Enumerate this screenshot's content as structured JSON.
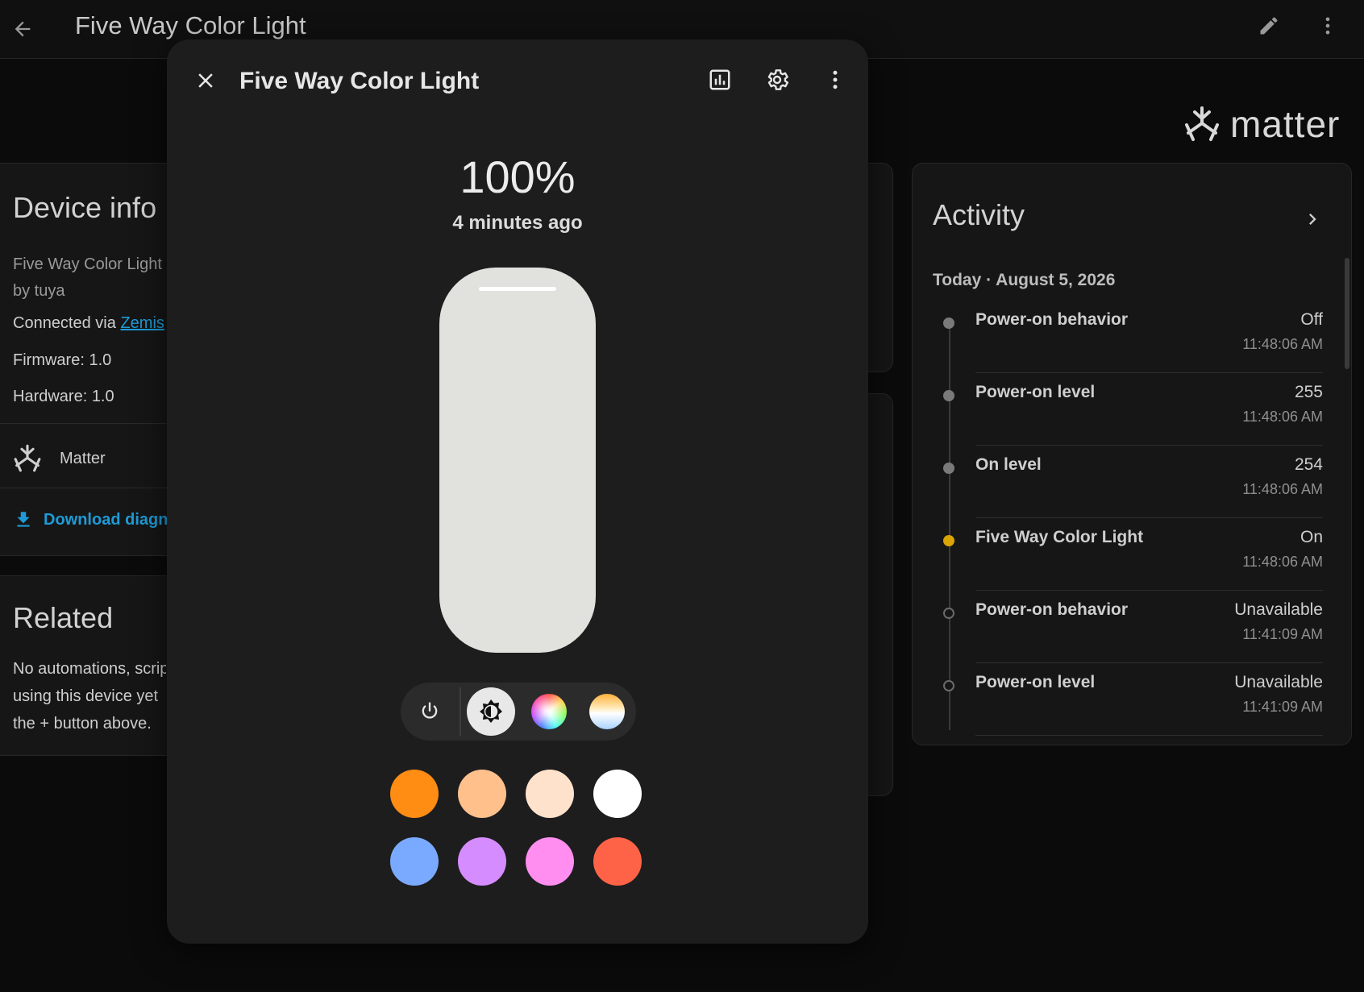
{
  "appbar": {
    "title": "Five Way Color Light"
  },
  "brand": {
    "word": "matter"
  },
  "device_info": {
    "title": "Device info",
    "model": "Five Way Color Light",
    "manufacturer": "by tuya",
    "connected_label": "Connected via",
    "connected_link": "Zemis",
    "firmware": "Firmware: 1.0",
    "hardware": "Hardware: 1.0",
    "integration": "Matter",
    "download": "Download diagnostics"
  },
  "related": {
    "title": "Related",
    "line1": "No automations, scripts,",
    "line2": "using this device yet",
    "line3": "the + button above."
  },
  "activity": {
    "title": "Activity",
    "date": "Today · August 5, 2026",
    "items": [
      {
        "name": "Power-on behavior",
        "value": "Off",
        "time": "11:48:06 AM",
        "dot": "#7a7a7a"
      },
      {
        "name": "Power-on level",
        "value": "255",
        "time": "11:48:06 AM",
        "dot": "#7a7a7a"
      },
      {
        "name": "On level",
        "value": "254",
        "time": "11:48:06 AM",
        "dot": "#7a7a7a"
      },
      {
        "name": "Five Way Color Light",
        "value": "On",
        "time": "11:48:06 AM",
        "dot": "#d9a404"
      },
      {
        "name": "Power-on behavior",
        "value": "Unavailable",
        "time": "11:41:09 AM",
        "dot": "hollow"
      },
      {
        "name": "Power-on level",
        "value": "Unavailable",
        "time": "11:41:09 AM",
        "dot": "hollow"
      }
    ]
  },
  "dialog": {
    "title": "Five Way Color Light",
    "brightness": "100%",
    "brightness_level": 1.0,
    "last_changed": "4 minutes ago",
    "modes": [
      "power",
      "brightness",
      "color",
      "color-temperature"
    ],
    "active_mode": "brightness",
    "presets": [
      "#ff8c13",
      "#ffc08c",
      "#ffe2cc",
      "#ffffff",
      "#7aaaff",
      "#d58cff",
      "#ff8ef0",
      "#ff6347"
    ]
  }
}
